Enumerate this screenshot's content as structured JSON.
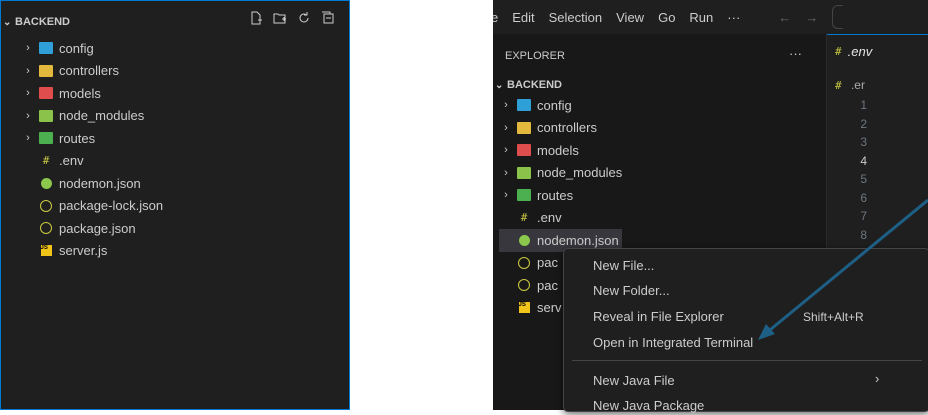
{
  "left": {
    "title": "BACKEND",
    "actions": [
      "new-file-icon",
      "new-folder-icon",
      "refresh-icon",
      "collapse-all-icon"
    ],
    "items": [
      {
        "label": "config",
        "type": "folder",
        "color": "#2f9fd8"
      },
      {
        "label": "controllers",
        "type": "folder",
        "color": "#e2b93d"
      },
      {
        "label": "models",
        "type": "folder",
        "color": "#e04d4d"
      },
      {
        "label": "node_modules",
        "type": "folder",
        "color": "#8bc34a"
      },
      {
        "label": "routes",
        "type": "folder",
        "color": "#4caf50"
      },
      {
        "label": ".env",
        "type": "env"
      },
      {
        "label": "nodemon.json",
        "type": "nodemon"
      },
      {
        "label": "package-lock.json",
        "type": "json"
      },
      {
        "label": "package.json",
        "type": "json"
      },
      {
        "label": "server.js",
        "type": "js"
      }
    ]
  },
  "right": {
    "menu": [
      "e",
      "Edit",
      "Selection",
      "View",
      "Go",
      "Run",
      "···"
    ],
    "explorer_title": "EXPLORER",
    "explorer_more": "···",
    "tree_title": "BACKEND",
    "items": [
      {
        "label": "config",
        "type": "folder",
        "color": "#2f9fd8"
      },
      {
        "label": "controllers",
        "type": "folder",
        "color": "#e2b93d"
      },
      {
        "label": "models",
        "type": "folder",
        "color": "#e04d4d"
      },
      {
        "label": "node_modules",
        "type": "folder",
        "color": "#8bc34a"
      },
      {
        "label": "routes",
        "type": "folder",
        "color": "#4caf50"
      },
      {
        "label": ".env",
        "type": "env"
      },
      {
        "label": "nodemon.json",
        "type": "nodemon"
      },
      {
        "label": "pac",
        "type": "json"
      },
      {
        "label": "pac",
        "type": "json"
      },
      {
        "label": "serv",
        "type": "js"
      }
    ],
    "editor_tab": ".env",
    "breadcrumb": ".er",
    "line_numbers": [
      "1",
      "2",
      "3",
      "4",
      "5",
      "6",
      "7",
      "8"
    ],
    "active_line": "4"
  },
  "context_menu": {
    "items": [
      {
        "label": "New File..."
      },
      {
        "label": "New Folder..."
      },
      {
        "label": "Reveal in File Explorer",
        "shortcut": "Shift+Alt+R"
      },
      {
        "label": "Open in Integrated Terminal"
      },
      {
        "label": "New Java File",
        "submenu": "›"
      },
      {
        "label": "New Java Package"
      }
    ]
  },
  "colors": {
    "accent": "#0078d4",
    "arrow": "#1e5f86",
    "bg": "#1f1f1f"
  }
}
